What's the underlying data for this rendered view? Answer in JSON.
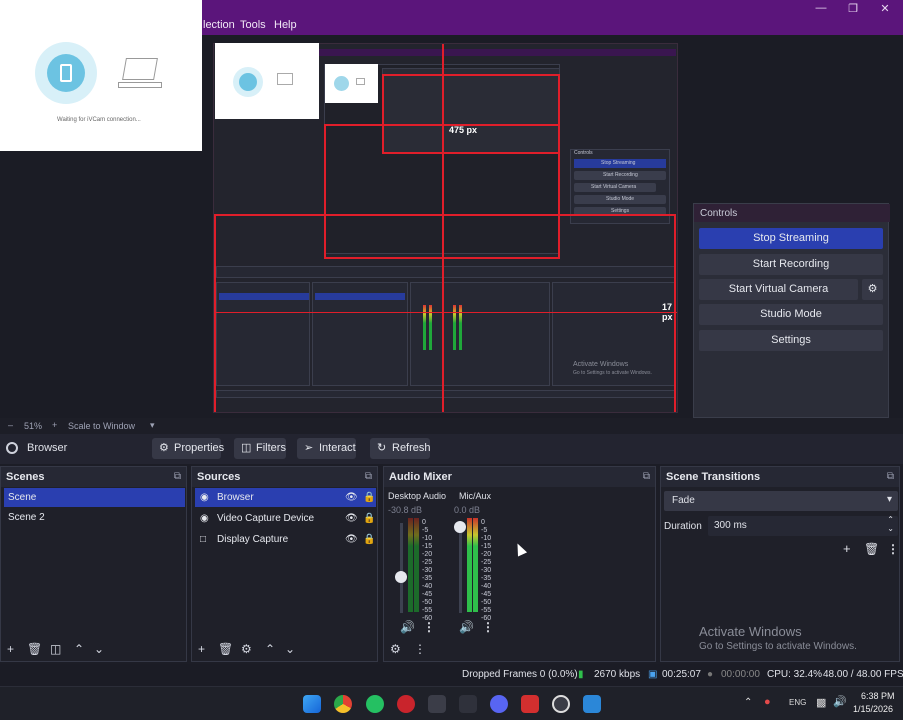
{
  "menubar": {
    "items": [
      "lection",
      "Tools",
      "Help"
    ]
  },
  "vcam": {
    "status_text": "Waiting for iVCam connection..."
  },
  "preview": {
    "label_475": "475 px",
    "label_17": "17 px",
    "inner_controls": [
      "Stop Streaming",
      "Start Recording",
      "Start Virtual Camera",
      "Studio Mode",
      "Settings"
    ],
    "inner_activate": "Activate Windows",
    "inner_activate_sub": "Go to Settings to activate Windows."
  },
  "controls": {
    "title": "Controls",
    "stop_streaming": "Stop Streaming",
    "start_recording": "Start Recording",
    "start_virtual_camera": "Start Virtual Camera",
    "studio_mode": "Studio Mode",
    "settings": "Settings"
  },
  "zoom": {
    "level": "51%",
    "mode": "Scale to Window"
  },
  "toolbar": {
    "source_name": "Browser",
    "properties": "Properties",
    "filters": "Filters",
    "interact": "Interact",
    "refresh": "Refresh"
  },
  "scenes": {
    "title": "Scenes",
    "items": [
      "Scene",
      "Scene 2"
    ]
  },
  "sources": {
    "title": "Sources",
    "items": [
      "Browser",
      "Video Capture Device",
      "Display Capture"
    ]
  },
  "mixer": {
    "title": "Audio Mixer",
    "channels": [
      {
        "name": "Desktop Audio",
        "db": "-30.8 dB"
      },
      {
        "name": "Mic/Aux",
        "db": "0.0 dB"
      }
    ],
    "scale": [
      "0",
      "-5",
      "-10",
      "-15",
      "-20",
      "-25",
      "-30",
      "-35",
      "-40",
      "-45",
      "-50",
      "-55",
      "-60"
    ]
  },
  "transitions": {
    "title": "Scene Transitions",
    "selected": "Fade",
    "duration_label": "Duration",
    "duration_value": "300 ms"
  },
  "status": {
    "dropped": "Dropped Frames 0 (0.0%)",
    "bitrate": "2670 kbps",
    "stream_time": "00:25:07",
    "rec_time": "00:00:00",
    "cpu": "CPU: 32.4%",
    "fps": "48.00 / 48.00 FPS"
  },
  "activate": {
    "title": "Activate Windows",
    "sub": "Go to Settings to activate Windows."
  },
  "taskbar": {
    "time": "6:38 PM",
    "date": "1/15/2026",
    "lang": "ENG"
  },
  "colors": {
    "titlebar": "#5b157b",
    "selection": "#2a3fb0",
    "accent_red": "#e01e2a"
  }
}
